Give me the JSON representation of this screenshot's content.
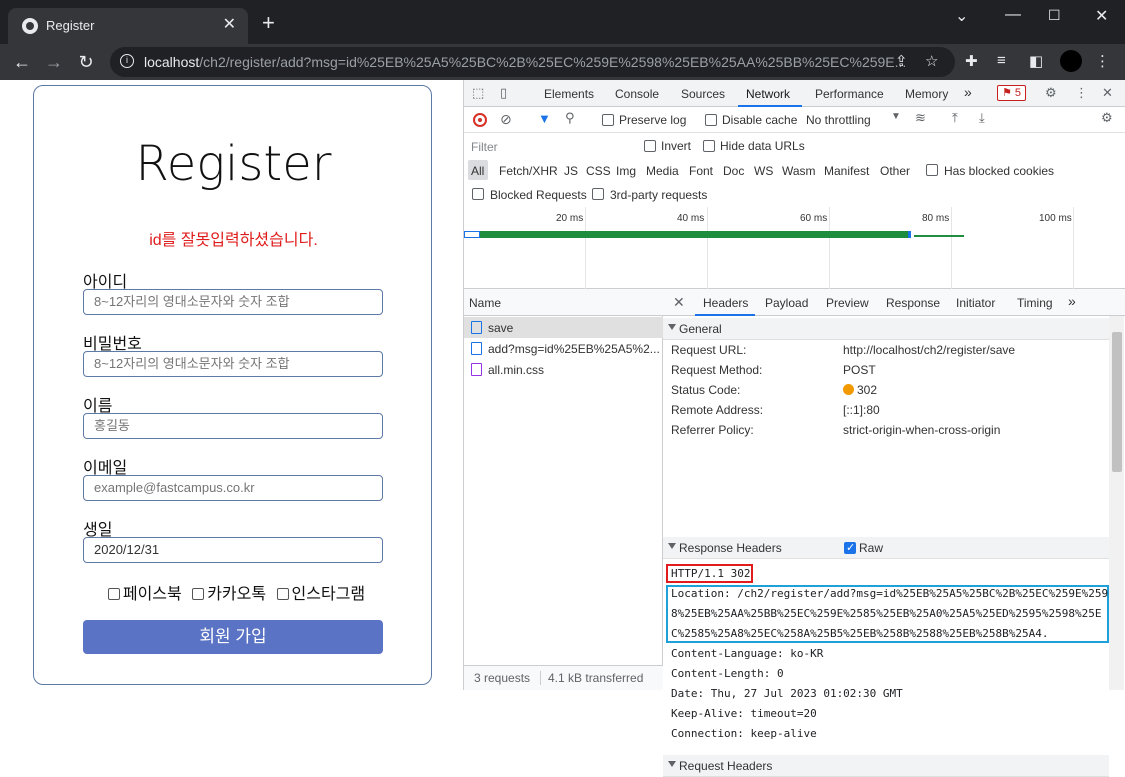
{
  "browser": {
    "tab_title": "Register",
    "tab_close": "✕",
    "new_tab": "+",
    "url_host": "localhost",
    "url_path": "/ch2/register/add?msg=id%25EB%25A5%25BC%2B%25EC%259E%2598%25EB%25AA%25BB%25EC%259E..."
  },
  "form": {
    "title": "Register",
    "error_msg": "id를 잘못입력하셨습니다.",
    "id_label": "아이디",
    "id_placeholder": "8~12자리의 영대소문자와 숫자 조합",
    "pw_label": "비밀번호",
    "pw_placeholder": "8~12자리의 영대소문자와 숫자 조합",
    "name_label": "이름",
    "name_placeholder": "홍길동",
    "email_label": "이메일",
    "email_placeholder": "example@fastcampus.co.kr",
    "birth_label": "생일",
    "birth_value": "2020/12/31",
    "sns": [
      "페이스북",
      "카카오톡",
      "인스타그램"
    ],
    "submit": "회원 가입"
  },
  "devtools": {
    "tabs": [
      "Elements",
      "Console",
      "Sources",
      "Network",
      "Performance",
      "Memory"
    ],
    "active_tab": "Network",
    "more": "»",
    "error_count": "5",
    "preserve_log": "Preserve log",
    "disable_cache": "Disable cache",
    "throttling": "No throttling",
    "filter_placeholder": "Filter",
    "invert": "Invert",
    "hide_data_urls": "Hide data URLs",
    "filter_types": [
      "All",
      "Fetch/XHR",
      "JS",
      "CSS",
      "Img",
      "Media",
      "Font",
      "Doc",
      "WS",
      "Wasm",
      "Manifest",
      "Other"
    ],
    "has_blocked_cookies": "Has blocked cookies",
    "blocked_requests": "Blocked Requests",
    "third_party": "3rd-party requests",
    "timeline_labels": [
      "20 ms",
      "40 ms",
      "60 ms",
      "80 ms",
      "100 ms"
    ],
    "name_header": "Name",
    "requests": [
      {
        "name": "save",
        "type": "doc"
      },
      {
        "name": "add?msg=id%25EB%25A5%2...",
        "type": "doc"
      },
      {
        "name": "all.min.css",
        "type": "css"
      }
    ],
    "footer_requests": "3 requests",
    "footer_transferred": "4.1 kB transferred",
    "detail_tabs": [
      "Headers",
      "Payload",
      "Preview",
      "Response",
      "Initiator",
      "Timing"
    ],
    "active_detail_tab": "Headers",
    "general_title": "General",
    "general": [
      {
        "key": "Request URL:",
        "value": "http://localhost/ch2/register/save"
      },
      {
        "key": "Request Method:",
        "value": "POST"
      },
      {
        "key": "Status Code:",
        "value": "302"
      },
      {
        "key": "Remote Address:",
        "value": "[::1]:80"
      },
      {
        "key": "Referrer Policy:",
        "value": "strict-origin-when-cross-origin"
      }
    ],
    "response_headers_title": "Response Headers",
    "raw_label": "Raw",
    "raw_lines": [
      "HTTP/1.1 302",
      "Location: /ch2/register/add?msg=id%25EB%25A5%25BC%2B%25EC%259E%259",
      "8%25EB%25AA%25BB%25EC%259E%2585%25EB%25A0%25A5%25ED%2595%2598%25E",
      "C%2585%25A8%25EC%258A%25B5%25EB%258B%2588%25EB%258B%25A4.",
      "Content-Language: ko-KR",
      "Content-Length: 0",
      "Date: Thu, 27 Jul 2023 01:02:30 GMT",
      "Keep-Alive: timeout=20",
      "Connection: keep-alive"
    ],
    "request_headers_title": "Request Headers"
  },
  "colors": {
    "accent": "#1a73e8",
    "error": "#e01c1c",
    "submit_bg": "#5b73c4",
    "highlight_blue": "#1ea0d8"
  }
}
